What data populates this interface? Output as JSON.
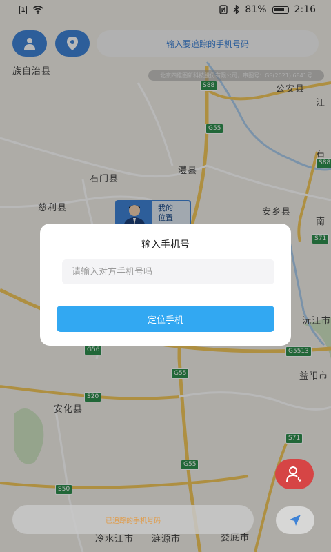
{
  "status_bar": {
    "battery": "81%",
    "time": "2:16",
    "icons": [
      "sim-icon",
      "wifi-icon",
      "nfc-icon",
      "bluetooth-icon",
      "battery-icon"
    ]
  },
  "top_bar": {
    "user_button_icon": "user-icon",
    "location_button_icon": "location-pin-icon",
    "search_placeholder": "输入要追踪的手机号码"
  },
  "map": {
    "attribution": "北京四维图新科技股份有限公司，审图号：GS(2021) 6841号",
    "places": [
      "族自治县",
      "公安县",
      "江",
      "石",
      "石门县",
      "澧县",
      "慈利县",
      "安乡县",
      "南",
      "沅江市",
      "益阳市",
      "安化县",
      "冷水江市",
      "涟源市",
      "娄底市"
    ],
    "road_shields": [
      "S88",
      "G55",
      "S88",
      "S71",
      "G56",
      "G5513",
      "G55",
      "S20",
      "S71",
      "G55",
      "S50"
    ],
    "my_location_label": "我的位置"
  },
  "dialog": {
    "title": "输入手机号",
    "input_placeholder": "请输入对方手机号吗",
    "input_value": "",
    "locate_button": "定位手机"
  },
  "bottom": {
    "tracked_numbers_label": "已追踪的手机号码",
    "contact_button_icon": "phone-contact-icon",
    "navigate_button_icon": "navigation-arrow-icon"
  },
  "colors": {
    "accent_blue": "#3f83d6",
    "button_blue": "#32a8f2",
    "contact_red": "#d64545",
    "tracked_label_orange": "#e19a45",
    "shield_green": "#2f8f4e"
  }
}
